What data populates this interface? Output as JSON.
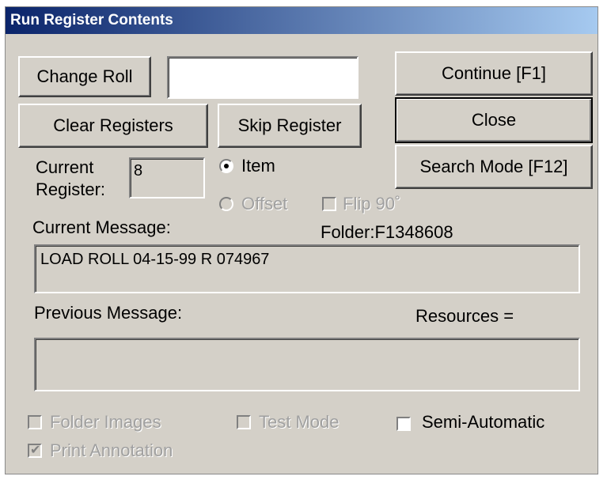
{
  "window": {
    "title": "Run Register Contents"
  },
  "buttons": {
    "change_roll": "Change Roll",
    "clear_registers": "Clear Registers",
    "skip_register": "Skip Register",
    "continue": "Continue [F1]",
    "close": "Close",
    "search_mode": "Search Mode [F12]"
  },
  "roll_input": {
    "value": ""
  },
  "current_register": {
    "label_line1": "Current",
    "label_line2": "Register:",
    "value": "8"
  },
  "mode": {
    "item_label": "Item",
    "offset_label": "Offset",
    "selected": "Item",
    "flip_label": "Flip 90˚",
    "flip_checked": false
  },
  "current_message": {
    "label": "Current Message:",
    "text": "LOAD ROLL 04-15-99 R 074967"
  },
  "folder": {
    "text": "Folder:F1348608"
  },
  "previous_message": {
    "label": "Previous Message:",
    "text": ""
  },
  "resources": {
    "text": "Resources ="
  },
  "options": {
    "folder_images": {
      "label": "Folder Images",
      "checked": false,
      "enabled": false
    },
    "test_mode": {
      "label": "Test Mode",
      "checked": false,
      "enabled": false
    },
    "semi_automatic": {
      "label": "Semi-Automatic",
      "checked": false,
      "enabled": true
    },
    "print_annotation": {
      "label": "Print Annotation",
      "checked": true,
      "enabled": false
    }
  }
}
